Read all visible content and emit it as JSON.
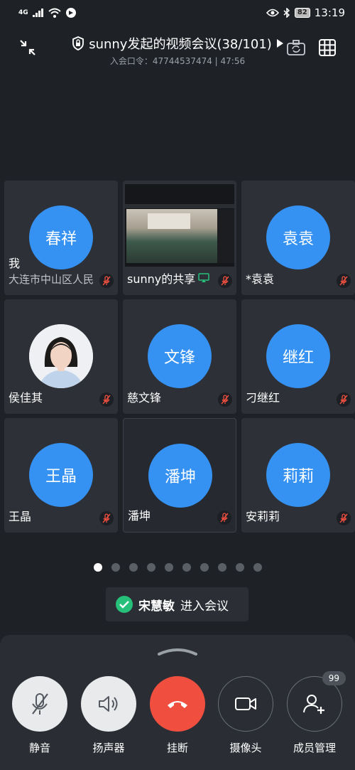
{
  "status_bar": {
    "network": "4G",
    "battery": "82",
    "time": "13:19"
  },
  "header": {
    "title": "sunny发起的视频会议(38/101)",
    "subtitle": "入会口令：47744537474 | 47:56"
  },
  "participants": [
    {
      "avatar": "春祥",
      "name": "我",
      "sub": "大连市中山区人民",
      "muted": true
    },
    {
      "share": true,
      "name": "sunny的共享",
      "muted": true
    },
    {
      "avatar": "袁袁",
      "name": "*袁袁",
      "muted": true
    },
    {
      "photo": true,
      "name": "侯佳其",
      "muted": true
    },
    {
      "avatar": "文锋",
      "name": "慈文锋",
      "muted": true
    },
    {
      "avatar": "继红",
      "name": "刁继红",
      "muted": true
    },
    {
      "avatar": "王晶",
      "name": "王晶",
      "muted": true
    },
    {
      "avatar": "潘坤",
      "name": "潘坤",
      "muted": true,
      "active": true
    },
    {
      "avatar": "莉莉",
      "name": "安莉莉",
      "muted": true
    }
  ],
  "pager": {
    "total": 10,
    "current": 1
  },
  "toast": {
    "who": "宋慧敏",
    "action": "进入会议"
  },
  "controls": [
    {
      "label": "静音",
      "icon": "mic-muted-icon"
    },
    {
      "label": "扬声器",
      "icon": "speaker-icon"
    },
    {
      "label": "挂断",
      "icon": "hang-up-icon"
    },
    {
      "label": "摄像头",
      "icon": "camera-icon"
    },
    {
      "label": "成员管理",
      "icon": "add-member-icon",
      "badge": "99"
    }
  ],
  "colors": {
    "avatar": "#3592f3",
    "hangup": "#f04f40",
    "success": "#27c07a",
    "background": "#1e2126"
  }
}
